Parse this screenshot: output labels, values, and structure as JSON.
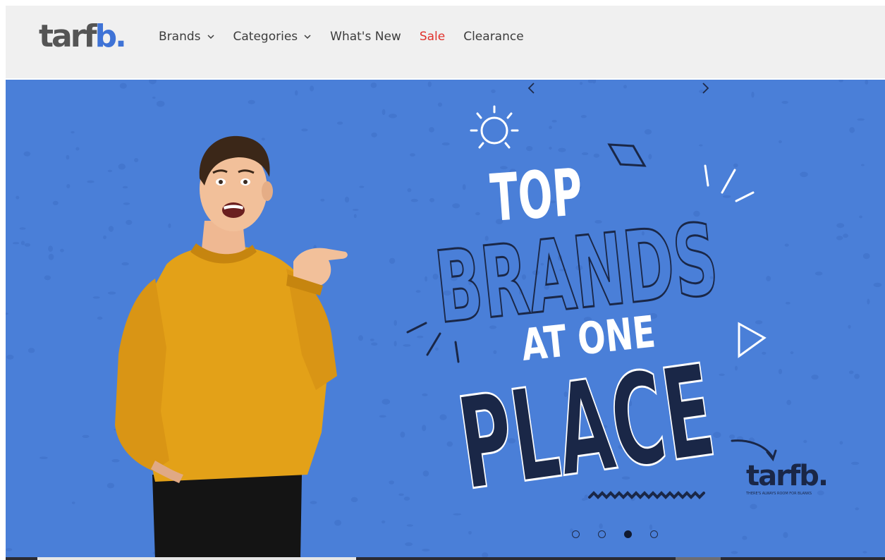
{
  "header": {
    "logo": {
      "main": "tarf",
      "accent": "b."
    },
    "nav": [
      {
        "label": "Brands",
        "has_dropdown": true
      },
      {
        "label": "Categories",
        "has_dropdown": true
      },
      {
        "label": "What's New",
        "has_dropdown": false
      },
      {
        "label": "Sale",
        "has_dropdown": false,
        "color": "#e0322c"
      },
      {
        "label": "Clearance",
        "has_dropdown": false
      }
    ]
  },
  "hero": {
    "background_color": "#4a7fd8",
    "headline": {
      "line1": "TOP",
      "line2": "BRANDS",
      "line3": "AT ONE",
      "line4": "PLACE"
    },
    "brand_mark": {
      "main": "tarf",
      "accent": "b.",
      "tagline": "THERE'S ALWAYS ROOM FOR BLANKS"
    },
    "carousel": {
      "prev_icon": "chevron-left-icon",
      "next_icon": "chevron-right-icon",
      "slide_count": 4,
      "active_index": 2
    }
  },
  "colors": {
    "accent_blue": "#3f73d6",
    "navy": "#1a2747",
    "sweater": "#e3a118"
  }
}
